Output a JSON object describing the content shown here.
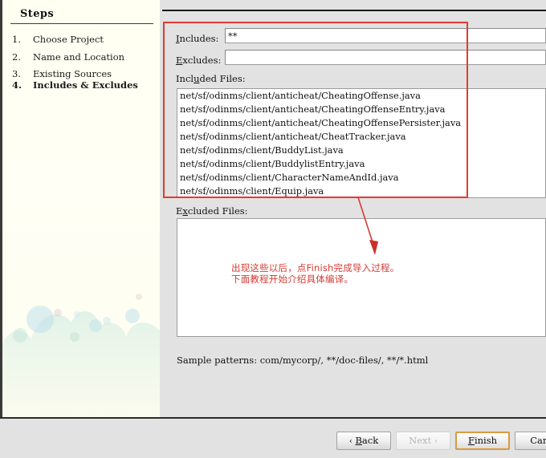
{
  "sidebar": {
    "title": "Steps",
    "steps": [
      {
        "num": "1.",
        "label": "Choose Project"
      },
      {
        "num": "2.",
        "label": "Name and Location"
      },
      {
        "num": "3.",
        "label": "Existing Sources"
      },
      {
        "num": "4.",
        "label": "Includes & Excludes"
      }
    ],
    "current_index": 3
  },
  "form": {
    "includes_label": "Includes:",
    "includes_mnemonic": "I",
    "includes_value": "**",
    "excludes_label": "Excludes:",
    "excludes_mnemonic": "E",
    "excludes_value": "",
    "included_files_label": "Included Files:",
    "included_files_mnemonic": "u",
    "excluded_files_label": "Excluded Files:",
    "excluded_files_mnemonic": "x",
    "included_files": [
      "net/sf/odinms/client/anticheat/CheatingOffense.java",
      "net/sf/odinms/client/anticheat/CheatingOffenseEntry.java",
      "net/sf/odinms/client/anticheat/CheatingOffensePersister.java",
      "net/sf/odinms/client/anticheat/CheatTracker.java",
      "net/sf/odinms/client/BuddyList.java",
      "net/sf/odinms/client/BuddylistEntry.java",
      "net/sf/odinms/client/CharacterNameAndId.java",
      "net/sf/odinms/client/Equip.java"
    ],
    "excluded_files": [],
    "sample_patterns": "Sample patterns: com/mycorp/, **/doc-files/, **/*.html"
  },
  "annotations": {
    "note_line1": "出现这些以后，点Finish完成导入过程。",
    "note_line2": "下面教程开始介绍具体编译。",
    "highlight_color": "#e33a33",
    "note_color": "#d63a33"
  },
  "buttons": {
    "back": "Back",
    "back_mnemonic": "B",
    "back_arrow": "‹",
    "next": "Next",
    "next_arrow": "›",
    "finish": "Finish",
    "finish_mnemonic": "F",
    "cancel": "Canc"
  }
}
